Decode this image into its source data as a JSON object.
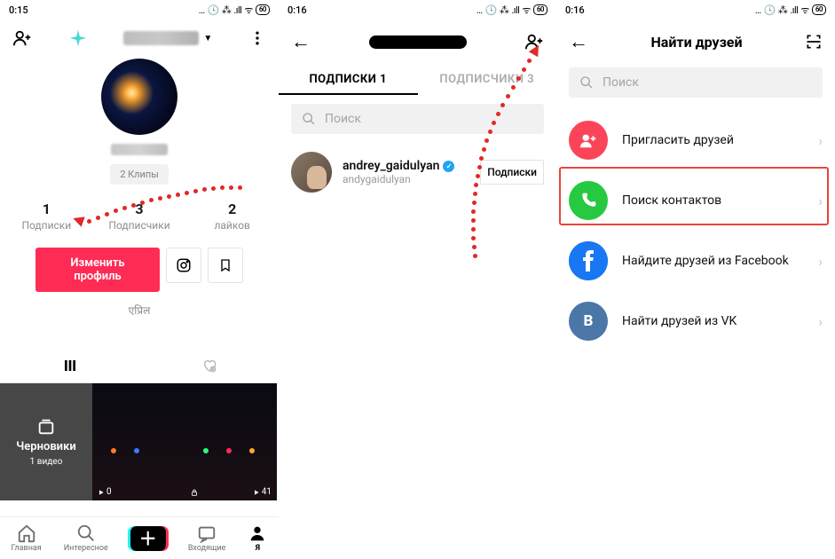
{
  "status": {
    "time1": "0:15",
    "time2": "0:16",
    "time3": "0:16",
    "battery": "60",
    "icons": "…   ⏰ ⁂ .ıll ᯤ"
  },
  "screen1": {
    "username_hidden": "█████",
    "handle_hidden": "████",
    "clips_label": "2 Клипы",
    "counts": {
      "following": {
        "num": "1",
        "label": "Подписки"
      },
      "followers": {
        "num": "3",
        "label": "Подписчики"
      },
      "likes": {
        "num": "2",
        "label": "лайков"
      }
    },
    "edit_profile": "Изменить профиль",
    "promo": "एप्रिल",
    "drafts_title": "Черновики",
    "drafts_sub": "1 видео",
    "thumb2_views": "0",
    "thumb3_views": "41",
    "bottom": {
      "home": "Главная",
      "discover": "Интересное",
      "inbox": "Входящие",
      "me": "Я"
    }
  },
  "screen2": {
    "tab_following": "ПОДПИСКИ 1",
    "tab_followers": "ПОДПИСЧИКИ 3",
    "search_placeholder": "Поиск",
    "friend_name": "andrey_gaidulyan",
    "friend_handle": "andygaidulyan",
    "follow_button": "Подписки"
  },
  "screen3": {
    "title": "Найти друзей",
    "search_placeholder": "Поиск",
    "opt_invite": "Пригласить друзей",
    "opt_contacts": "Поиск контактов",
    "opt_facebook": "Найдите друзей из Facebook",
    "opt_vk": "Найти друзей из VK"
  }
}
